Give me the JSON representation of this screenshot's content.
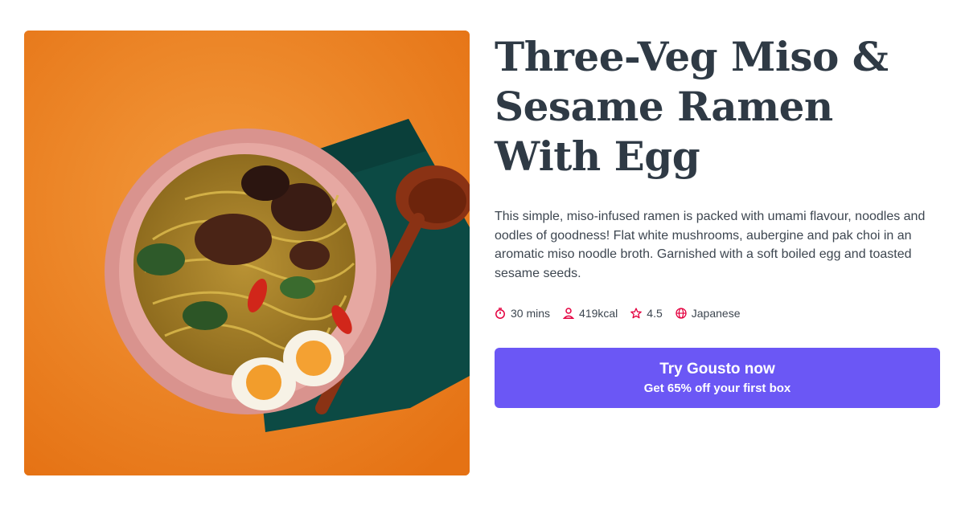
{
  "recipe": {
    "title": "Three-Veg Miso & Sesame Ramen With Egg",
    "description": "This simple, miso-infused ramen is packed with umami flavour, noodles and oodles of goodness! Flat white mushrooms, aubergine and pak choi in an aromatic miso noodle broth. Garnished with a soft boiled egg and toasted sesame seeds.",
    "image_icon": "ramen-bowl-photo"
  },
  "meta": {
    "time": {
      "label": "30 mins",
      "icon": "timer-icon"
    },
    "calories": {
      "label": "419kcal",
      "icon": "person-icon"
    },
    "rating": {
      "label": "4.5",
      "icon": "star-icon"
    },
    "cuisine": {
      "label": "Japanese",
      "icon": "globe-icon"
    }
  },
  "cta": {
    "main": "Try Gousto now",
    "sub": "Get 65% off your first box"
  },
  "colors": {
    "title": "#2f3a45",
    "text": "#3d4650",
    "icon": "#e4003f",
    "cta_bg": "#6b57f5",
    "cta_text": "#ffffff"
  }
}
